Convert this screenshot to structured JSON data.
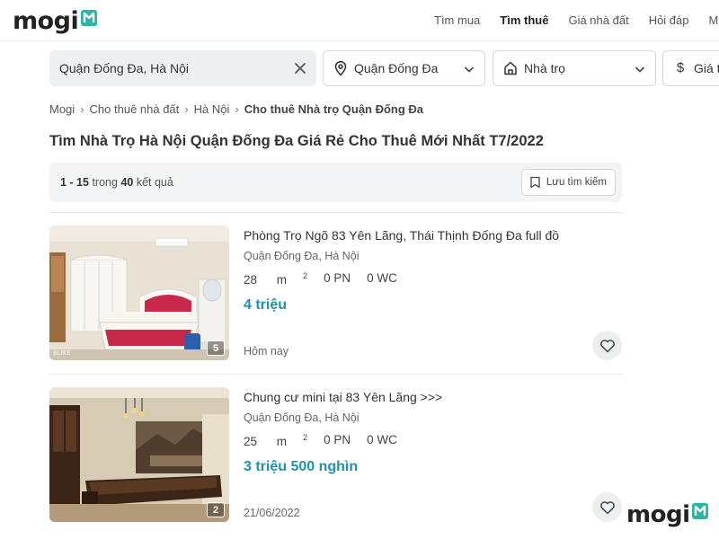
{
  "brand": {
    "logo_text": "mogi",
    "accent": "#1e93a8",
    "logo_mark_color": "#2bb5a3"
  },
  "nav": {
    "items": [
      "Tìm mua",
      "Tìm thuê",
      "Giá nhà đất",
      "Hỏi đáp",
      "Mô"
    ],
    "active": "Tìm thuê"
  },
  "search": {
    "value": "Quận Đống Đa, Hà Nội",
    "clear_icon": "close-icon"
  },
  "filters": {
    "district": {
      "label": "Quận Đống Đa",
      "icon": "location-pin-icon"
    },
    "type": {
      "label": "Nhà trọ",
      "icon": "house-icon"
    },
    "price": {
      "label": "Giá t",
      "icon": "dollar-icon"
    }
  },
  "breadcrumb": [
    "Mogi",
    "Cho thuê nhà đất",
    "Hà Nội",
    "Cho thuê Nhà trọ Quận Đống Đa"
  ],
  "page_title": "Tìm Nhà Trọ Hà Nội Quận Đống Đa Giá Rẻ Cho Thuê Mới Nhất T7/2022",
  "results": {
    "range": "1 - 15",
    "in_text": "trong",
    "total": "40",
    "suffix": "kết quả",
    "save_search_label": "Lưu tìm kiếm"
  },
  "listings": [
    {
      "title": "Phòng Trọ Ngõ 83 Yên Lãng, Thái Thịnh Đống Đa full đồ",
      "location": "Quận Đống Đa, Hà Nội",
      "area": "28",
      "area_unit": "m",
      "bedrooms": "0 PN",
      "bathrooms": "0 WC",
      "price": "4 triệu",
      "date": "Hôm nay",
      "photo_count": "5"
    },
    {
      "title": "Chung cư mini tại 83 Yên Lãng >>>",
      "location": "Quận Đống Đa, Hà Nội",
      "area": "25",
      "area_unit": "m",
      "bedrooms": "0 PN",
      "bathrooms": "0 WC",
      "price": "3 triệu 500 nghìn",
      "date": "21/06/2022",
      "photo_count": "2"
    }
  ],
  "watermark": {
    "text": "mogi"
  }
}
